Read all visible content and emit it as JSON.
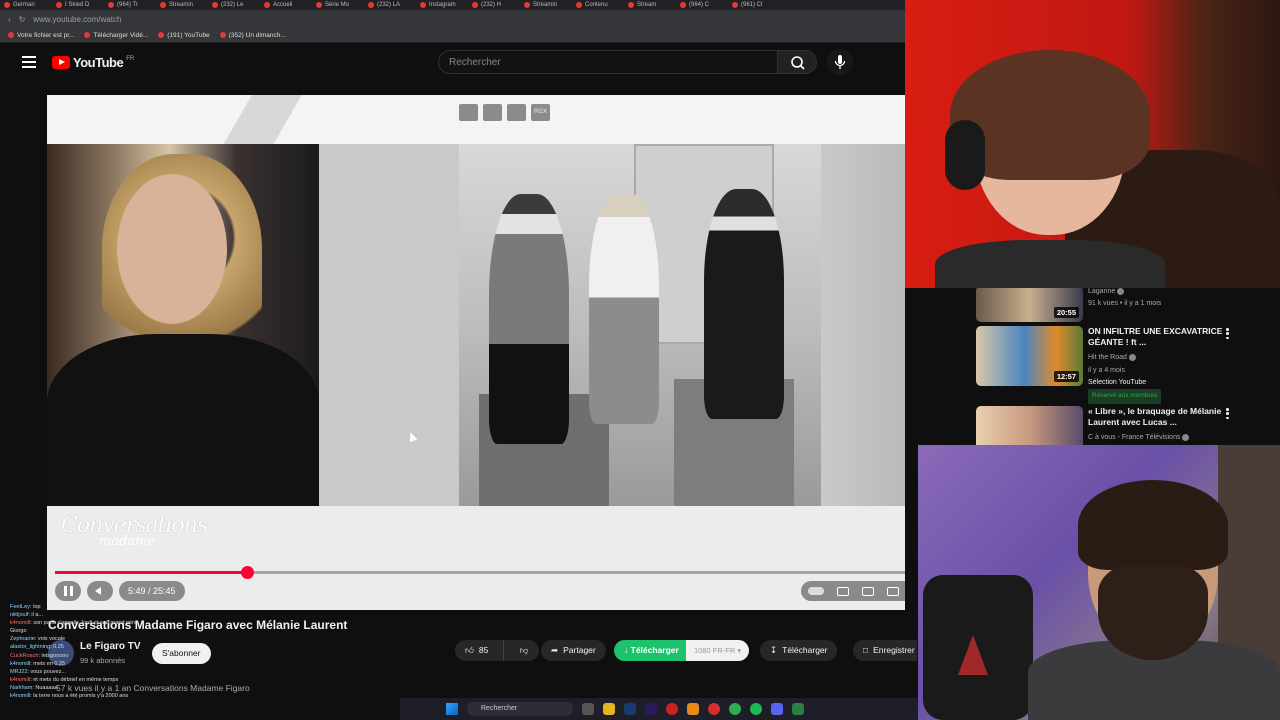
{
  "browser": {
    "tabs": [
      "German",
      "I Skied D",
      "(964) Tr",
      "Streamin",
      "(232) Le",
      "Accueil",
      "Série Mo",
      "(232) LA",
      "Instagram",
      "(232) H",
      "Streamin",
      "Contenu",
      "Stream",
      "(964) C",
      "(961) Cl"
    ],
    "url": "www.youtube.com/watch",
    "bookmarks": [
      "Votre fichier est pr...",
      "Télécharger Vidé...",
      "(191) YouTube",
      "(352) Un dimanch..."
    ]
  },
  "youtube": {
    "logo_word": "YouTube",
    "region": "FR",
    "search_placeholder": "Rechercher"
  },
  "player": {
    "toolbar_label": "RGX",
    "logo_line1": "Conversations",
    "logo_line2": "madame",
    "time": "5:49 / 25:45",
    "progress": 0.226
  },
  "video": {
    "title": "Conversations Madame Figaro avec Mélanie Laurent",
    "channel": "Le Figaro TV",
    "subscribers": "99 k abonnés",
    "subscribe_label": "S'abonner",
    "likes": "85",
    "share_label": "Partager",
    "download_green": "Télécharger",
    "download_quality": "1080 FR-FR",
    "download_label": "Télécharger",
    "save_label": "Enregistrer",
    "description": "57 k vues  il y a 1 an  Conversations Madame Figaro"
  },
  "chat": [
    {
      "user": "FeetLey",
      "text": "top"
    },
    {
      "user": "nikljouif",
      "text": "il a..."
    },
    {
      "user": "k4nomill",
      "text": "son papa s'appelle Jordi et son grand père Giorgo"
    },
    {
      "user": "Zephranie",
      "text": "voix vocale"
    },
    {
      "user": "alastor_lightning",
      "text": "0.25"
    },
    {
      "user": "CuckRoach",
      "text": "letsgooooo"
    },
    {
      "user": "k4nomill",
      "text": "mets en 0.25"
    },
    {
      "user": "MRJ22",
      "text": "vous pouvez..."
    },
    {
      "user": "k4nomill",
      "text": "et mets du débrief en même temps"
    },
    {
      "user": "Narkham",
      "text": "Nuaaaaa"
    },
    {
      "user": "k4nomill",
      "text": "la terre nous a été promis y'a 2000 ans"
    }
  ],
  "taskbar": {
    "search_label": "Rechercher"
  },
  "related": [
    {
      "channel": "Laganne",
      "meta": "91 k vues • il y a 1 mois",
      "duration": "20:55"
    },
    {
      "title": "ON INFILTRE UNE EXCAVATRICE GÉANTE ! ft ...",
      "channel": "Hit the Road",
      "meta": "il y a 4 mois",
      "duration": "12:57",
      "extra": "Sélection YouTube",
      "badge": "Réservé aux membres"
    },
    {
      "title": "« Libre », le braquage de Mélanie Laurent avec Lucas ...",
      "channel": "C à vous - France Télévisions"
    }
  ]
}
